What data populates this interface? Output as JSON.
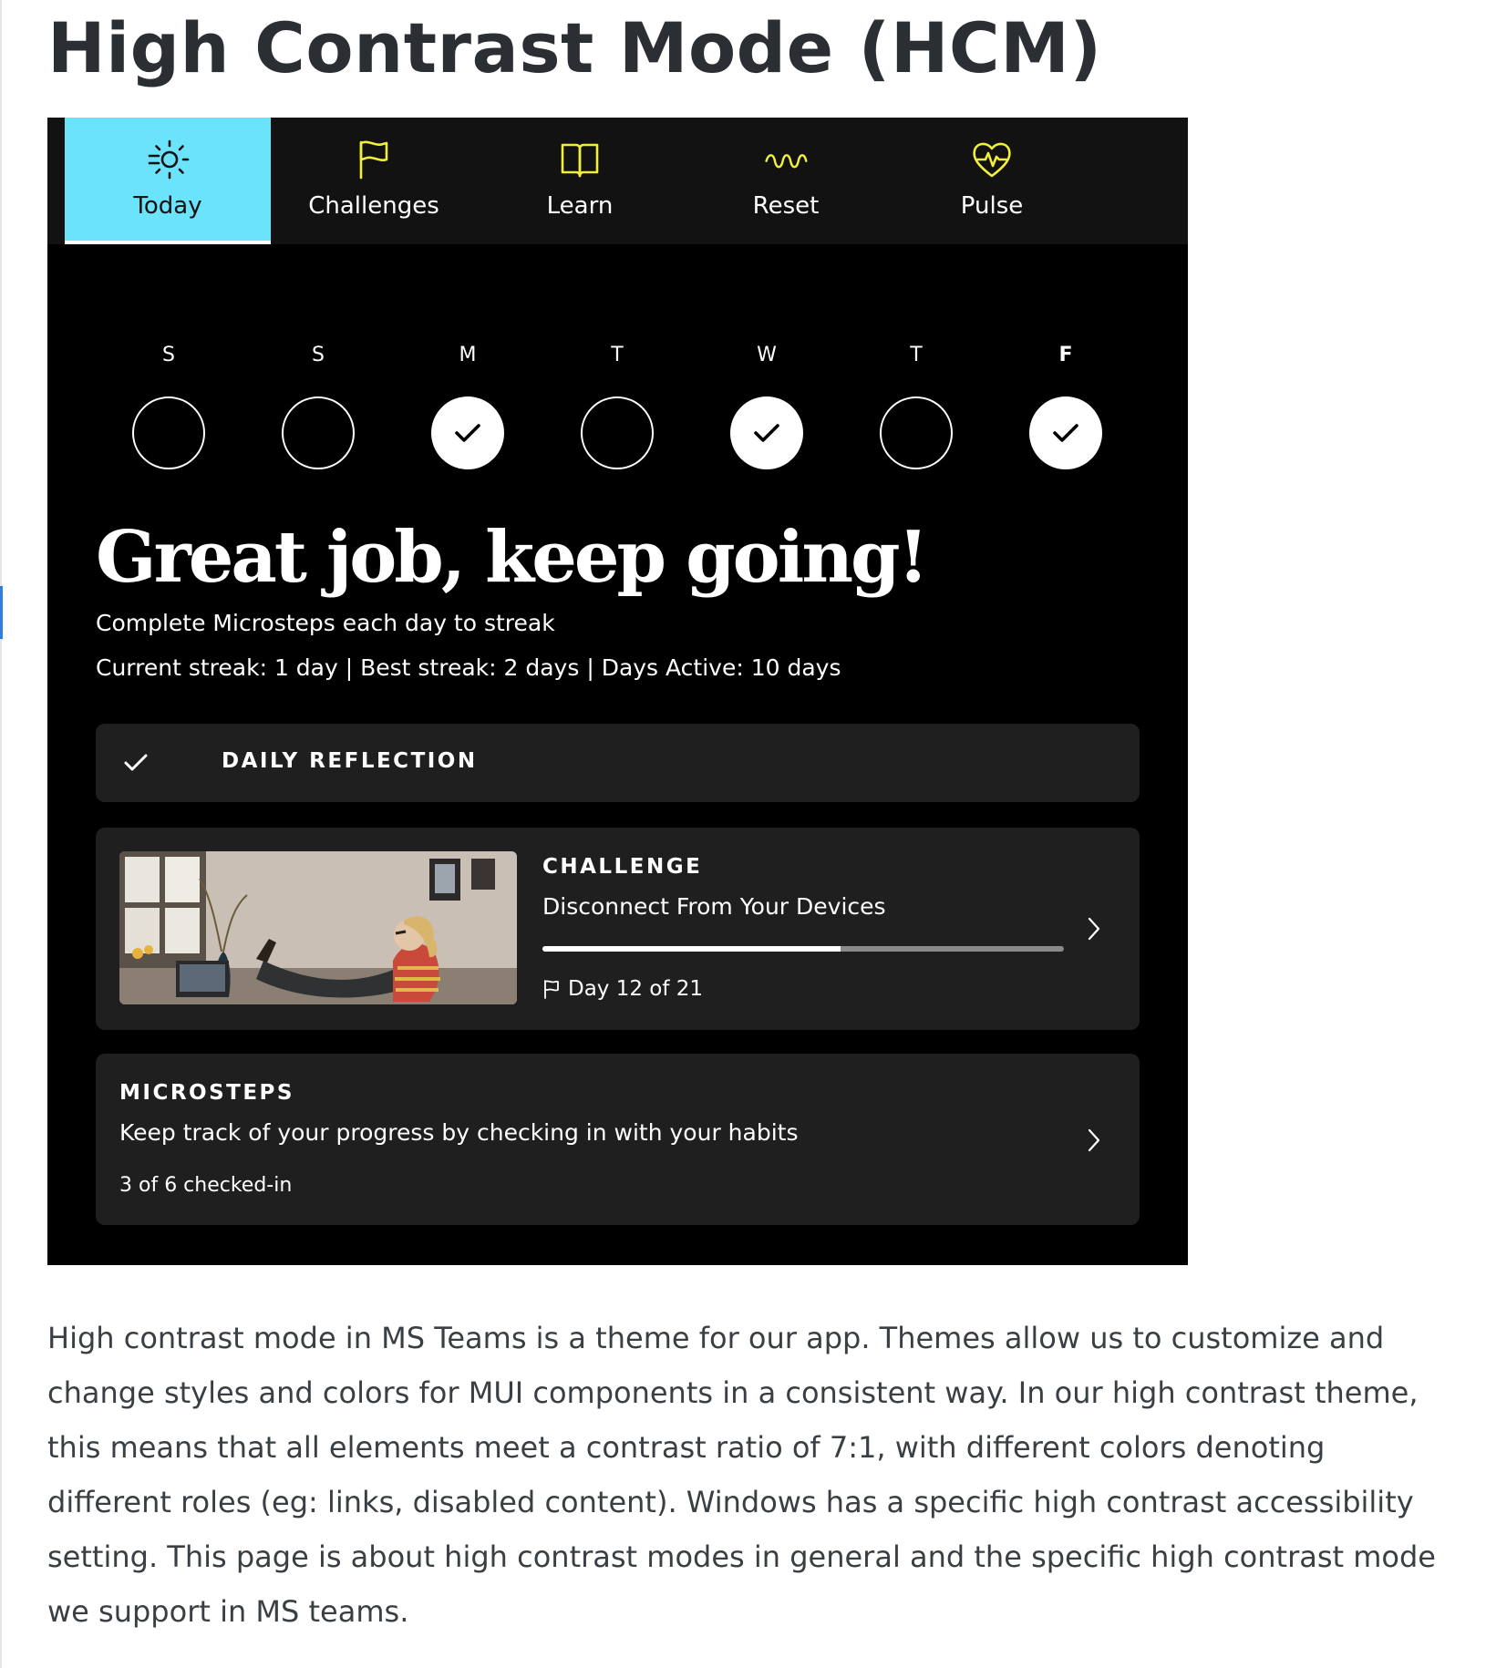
{
  "page": {
    "title": "High Contrast Mode (HCM)",
    "paragraph": "High contrast mode in MS Teams is a theme for our app. Themes allow us to customize and change styles and colors for MUI components in a consistent way. In our high contrast theme, this means that all elements meet a contrast ratio of 7:1, with different colors denoting different roles (eg: links, disabled content). Windows has a specific high contrast accessibility setting. This page is about high contrast modes in general and the specific high contrast mode we support in MS teams."
  },
  "colors": {
    "active_tab": "#6ae3fb",
    "tab_icon": "#f0f03c",
    "app_background": "#000000",
    "card_background": "#1f1f1f"
  },
  "nav": {
    "tabs": [
      {
        "label": "Today",
        "icon": "sun-icon",
        "active": true
      },
      {
        "label": "Challenges",
        "icon": "flag-icon",
        "active": false
      },
      {
        "label": "Learn",
        "icon": "book-icon",
        "active": false
      },
      {
        "label": "Reset",
        "icon": "wave-icon",
        "active": false
      },
      {
        "label": "Pulse",
        "icon": "heart-pulse-icon",
        "active": false
      }
    ]
  },
  "week": {
    "days": [
      {
        "letter": "S",
        "done": false,
        "today": false
      },
      {
        "letter": "S",
        "done": false,
        "today": false
      },
      {
        "letter": "M",
        "done": true,
        "today": false
      },
      {
        "letter": "T",
        "done": false,
        "today": false
      },
      {
        "letter": "W",
        "done": true,
        "today": false
      },
      {
        "letter": "T",
        "done": false,
        "today": false
      },
      {
        "letter": "F",
        "done": true,
        "today": true
      }
    ]
  },
  "streak": {
    "headline": "Great job, keep going!",
    "subtitle": "Complete Microsteps each day to streak",
    "stats": "Current streak: 1 day | Best streak: 2 days | Days Active: 10 days"
  },
  "reflection": {
    "label": "DAILY REFLECTION",
    "icon": "check-icon"
  },
  "challenge": {
    "eyebrow": "CHALLENGE",
    "title": "Disconnect From Your Devices",
    "progress": 0.5714,
    "day_text": "Day 12 of 21",
    "icon": "flag-icon",
    "image": "woman relaxing with feet on desk next to laptop"
  },
  "microsteps": {
    "eyebrow": "MICROSTEPS",
    "title": "Keep track of your progress by checking in with your habits",
    "count_text": "3 of 6 checked-in"
  }
}
